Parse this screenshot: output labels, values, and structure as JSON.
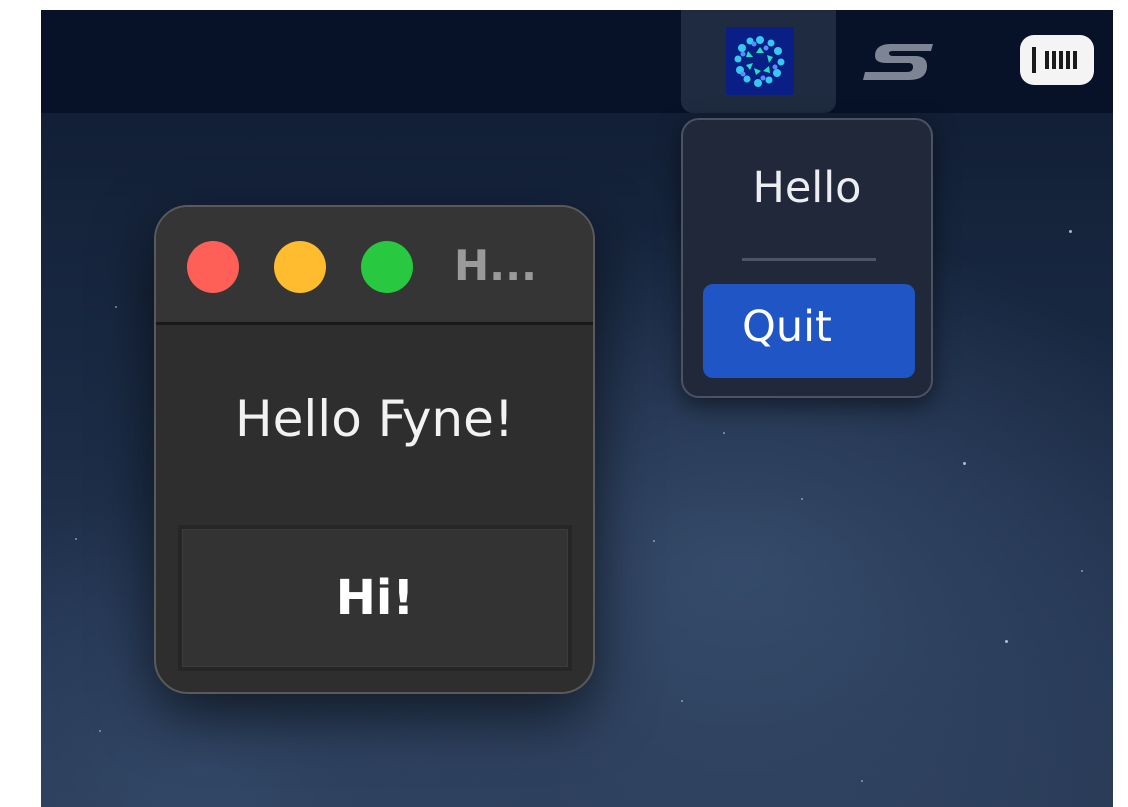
{
  "menubar": {
    "tray_icons": [
      "fyne-app-icon",
      "s-logo-icon",
      "battery-icon"
    ]
  },
  "tray_menu": {
    "items": [
      {
        "label": "Hello"
      },
      {
        "label": "Quit",
        "highlighted": true
      }
    ]
  },
  "window": {
    "title": "H...",
    "label": "Hello Fyne!",
    "button_label": "Hi!"
  },
  "colors": {
    "menu_highlight": "#1f55c4",
    "traffic_close": "#fe5f57",
    "traffic_minimize": "#febc2e",
    "traffic_zoom": "#28c840",
    "window_background": "#2e2e2e",
    "menubar_background": "#071228"
  }
}
